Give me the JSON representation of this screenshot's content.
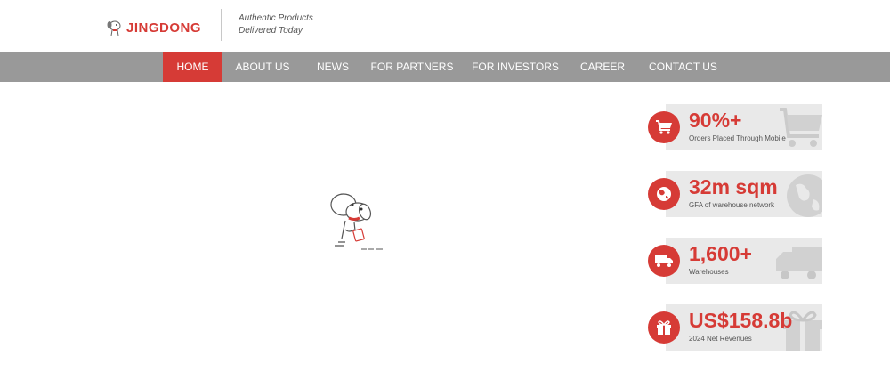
{
  "brand": {
    "name": "JINGDONG",
    "tagline_line1": "Authentic Products",
    "tagline_line2": "Delivered Today",
    "accent_color": "#d63b36"
  },
  "nav": {
    "items": [
      {
        "label": "HOME",
        "active": true
      },
      {
        "label": "ABOUT US",
        "active": false
      },
      {
        "label": "NEWS",
        "active": false
      },
      {
        "label": "FOR PARTNERS",
        "active": false
      },
      {
        "label": "FOR INVESTORS",
        "active": false
      },
      {
        "label": "CAREER",
        "active": false
      },
      {
        "label": "CONTACT US",
        "active": false
      }
    ],
    "bar_color": "#999999"
  },
  "stats": [
    {
      "value": "90%+",
      "label": "Orders Placed Through Mobile",
      "icon": "cart-icon"
    },
    {
      "value": "32m sqm",
      "label": "GFA of warehouse network",
      "icon": "globe-icon"
    },
    {
      "value": "1,600+",
      "label": "Warehouses",
      "icon": "truck-icon"
    },
    {
      "value": "US$158.8b",
      "label": "2024 Net Revenues",
      "icon": "gift-icon"
    }
  ]
}
